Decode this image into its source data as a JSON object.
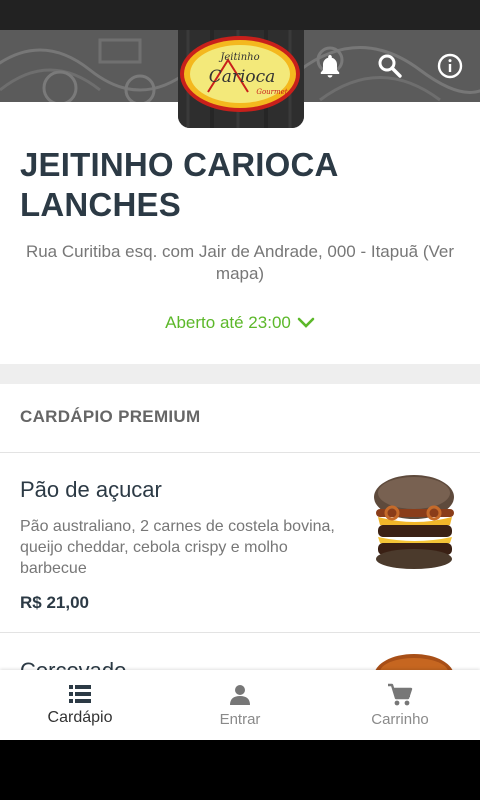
{
  "header": {
    "logo_text": "Jeitinho Carioca Gourmet"
  },
  "store": {
    "name": "JEITINHO CARIOCA LANCHES",
    "address": "Rua Curitiba esq. com Jair de Andrade, 000 - Itapuã (Ver mapa)",
    "hours": "Aberto até 23:00"
  },
  "menu": {
    "section_title": "CARDÁPIO PREMIUM",
    "products": [
      {
        "name": "Pão de açucar",
        "description": "Pão australiano, 2 carnes de costela bovina, queijo cheddar, cebola crispy e molho barbecue",
        "price": "R$ 21,00"
      },
      {
        "name": "Corcovado"
      }
    ]
  },
  "nav": {
    "items": [
      {
        "label": "Cardápio",
        "icon": "list-icon",
        "active": true
      },
      {
        "label": "Entrar",
        "icon": "person-icon",
        "active": false
      },
      {
        "label": "Carrinho",
        "icon": "cart-icon",
        "active": false
      }
    ]
  },
  "colors": {
    "accent_green": "#5cb82a",
    "title_dark": "#2c3a45"
  }
}
